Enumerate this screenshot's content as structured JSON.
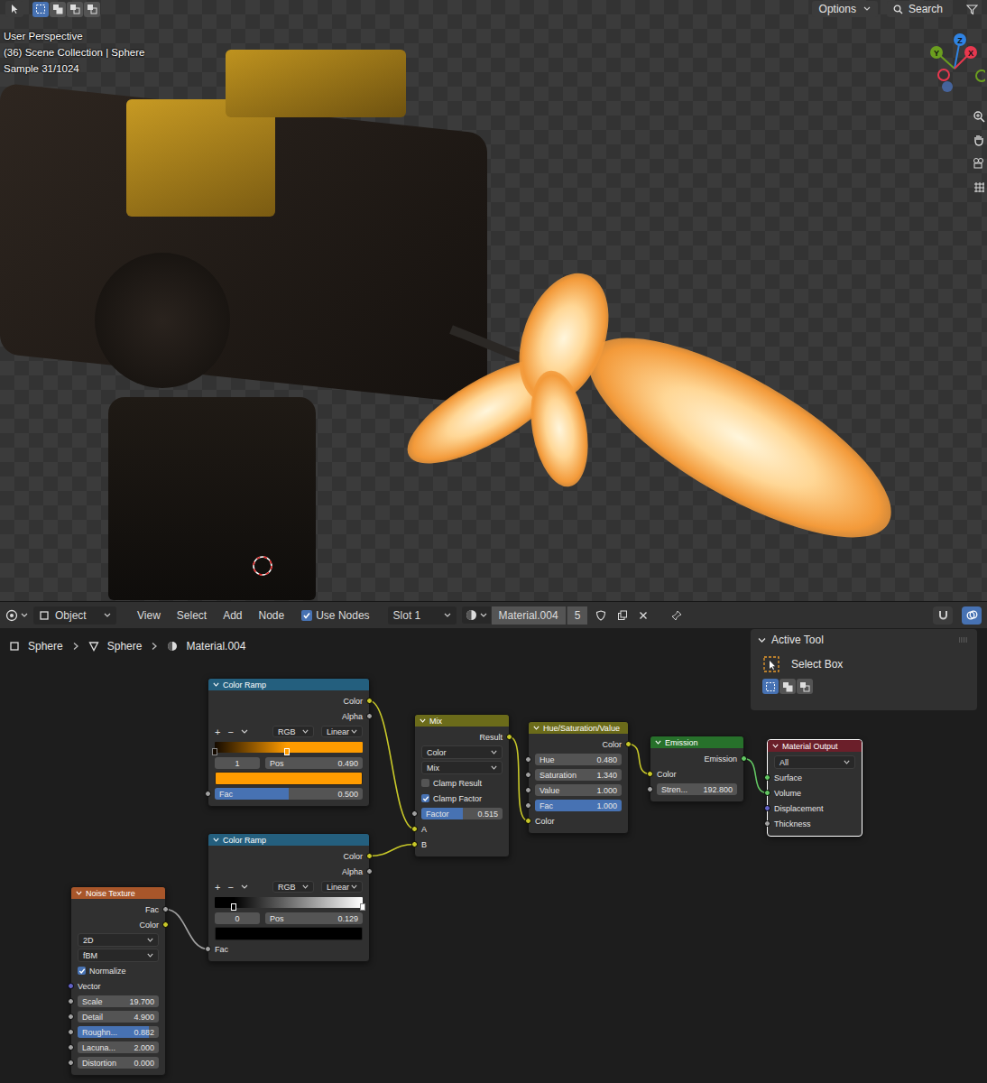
{
  "viewport": {
    "header": {
      "tool_modes": [
        {
          "selected": true
        },
        {
          "selected": false
        },
        {
          "selected": false
        },
        {
          "selected": false
        }
      ],
      "options": "Options",
      "search": "Search"
    },
    "overlay": [
      "User Perspective",
      "(36) Scene Collection | Sphere",
      "Sample 31/1024"
    ],
    "gizmo": {
      "axes": [
        {
          "label": "Y",
          "color": "#6b9e1f"
        },
        {
          "label": "Z",
          "color": "#2f83e3"
        },
        {
          "label": "X",
          "color": "#e8384f"
        }
      ]
    }
  },
  "editor_header": {
    "mode": "Object",
    "menus": [
      "View",
      "Select",
      "Add",
      "Node"
    ],
    "use_nodes": {
      "label": "Use Nodes",
      "checked": true
    },
    "slot": "Slot 1",
    "material": "Material.004",
    "users": "5",
    "toggles": [
      {
        "selected": false
      },
      {
        "selected": true
      }
    ]
  },
  "breadcrumb": [
    "Sphere",
    "Sphere",
    "Material.004"
  ],
  "active_tool": {
    "title": "Active Tool",
    "tool": "Select Box",
    "modes": [
      {
        "selected": true
      },
      {
        "selected": false
      },
      {
        "selected": false
      }
    ]
  },
  "nodes": [
    {
      "title": "Color Ramp",
      "color": "#245f7e",
      "selected": false,
      "rows": [
        {
          "kind": "output",
          "label": "Color",
          "socket": "color"
        },
        {
          "kind": "output",
          "label": "Alpha",
          "socket": "float"
        },
        {
          "kind": "ramp_tools",
          "buttons": [
            "+",
            "−"
          ],
          "mode": "RGB",
          "interpolation": "Linear"
        },
        {
          "kind": "ramp",
          "stops": [
            {
              "pos": 0,
              "color": "#140a00",
              "selected": false
            },
            {
              "pos": 0.49,
              "color": "#ff9c00",
              "selected": true
            }
          ]
        },
        {
          "kind": "stop",
          "index": "1",
          "label": "Pos",
          "value": "0.490"
        },
        {
          "kind": "swatch",
          "color": "#ff9c00"
        },
        {
          "kind": "field",
          "label": "Fac",
          "value": "0.500",
          "level": 0.5,
          "socket": "float"
        }
      ]
    },
    {
      "title": "Color Ramp",
      "color": "#245f7e",
      "selected": false,
      "rows": [
        {
          "kind": "output",
          "label": "Color",
          "socket": "color"
        },
        {
          "kind": "output",
          "label": "Alpha",
          "socket": "float"
        },
        {
          "kind": "ramp_tools",
          "buttons": [
            "+",
            "−"
          ],
          "mode": "RGB",
          "interpolation": "Linear"
        },
        {
          "kind": "ramp",
          "stops": [
            {
              "pos": 0.129,
              "color": "#000000",
              "selected": true
            },
            {
              "pos": 1,
              "color": "#ffffff",
              "selected": false
            }
          ]
        },
        {
          "kind": "stop",
          "index": "0",
          "label": "Pos",
          "value": "0.129"
        },
        {
          "kind": "swatch",
          "color": "#000000"
        },
        {
          "kind": "input",
          "label": "Fac",
          "socket": "float"
        }
      ]
    },
    {
      "title": "Noise Texture",
      "color": "#a8562a",
      "selected": false,
      "rows": [
        {
          "kind": "output",
          "label": "Fac",
          "socket": "float"
        },
        {
          "kind": "output",
          "label": "Color",
          "socket": "color"
        },
        {
          "kind": "dropdown",
          "value": "2D"
        },
        {
          "kind": "dropdown",
          "value": "fBM"
        },
        {
          "kind": "check",
          "label": "Normalize",
          "checked": true
        },
        {
          "kind": "input",
          "label": "Vector",
          "socket": "vector"
        },
        {
          "kind": "field",
          "label": "Scale",
          "value": "19.700",
          "socket": "float"
        },
        {
          "kind": "field",
          "label": "Detail",
          "value": "4.900",
          "socket": "float"
        },
        {
          "kind": "field",
          "label": "Roughn...",
          "value": "0.882",
          "level": 0.882,
          "socket": "float"
        },
        {
          "kind": "field",
          "label": "Lacuna...",
          "value": "2.000",
          "socket": "float"
        },
        {
          "kind": "field",
          "label": "Distortion",
          "value": "0.000",
          "socket": "float"
        }
      ]
    },
    {
      "title": "Mix",
      "color": "#6b6b1a",
      "selected": false,
      "rows": [
        {
          "kind": "output",
          "label": "Result",
          "socket": "color"
        },
        {
          "kind": "dropdown",
          "value": "Color"
        },
        {
          "kind": "dropdown",
          "value": "Mix"
        },
        {
          "kind": "check",
          "label": "Clamp Result",
          "checked": false
        },
        {
          "kind": "check",
          "label": "Clamp Factor",
          "checked": true
        },
        {
          "kind": "field",
          "label": "Factor",
          "value": "0.515",
          "level": 0.515,
          "socket": "float"
        },
        {
          "kind": "input",
          "label": "A",
          "socket": "color"
        },
        {
          "kind": "input",
          "label": "B",
          "socket": "color"
        }
      ]
    },
    {
      "title": "Hue/Saturation/Value",
      "color": "#6b6b1a",
      "selected": false,
      "rows": [
        {
          "kind": "output",
          "label": "Color",
          "socket": "color"
        },
        {
          "kind": "field",
          "label": "Hue",
          "value": "0.480",
          "socket": "float"
        },
        {
          "kind": "field",
          "label": "Saturation",
          "value": "1.340",
          "socket": "float"
        },
        {
          "kind": "field",
          "label": "Value",
          "value": "1.000",
          "socket": "float"
        },
        {
          "kind": "field",
          "label": "Fac",
          "value": "1.000",
          "level": 1,
          "socket": "float"
        },
        {
          "kind": "input",
          "label": "Color",
          "socket": "color"
        }
      ]
    },
    {
      "title": "Emission",
      "color": "#27712b",
      "selected": false,
      "rows": [
        {
          "kind": "output",
          "label": "Emission",
          "socket": "shader"
        },
        {
          "kind": "input",
          "label": "Color",
          "socket": "color"
        },
        {
          "kind": "field",
          "label": "Stren...",
          "value": "192.800",
          "socket": "float"
        }
      ]
    },
    {
      "title": "Material Output",
      "color": "#6b1f2a",
      "selected": true,
      "rows": [
        {
          "kind": "dropdown",
          "value": "All"
        },
        {
          "kind": "input",
          "label": "Surface",
          "socket": "shader"
        },
        {
          "kind": "input",
          "label": "Volume",
          "socket": "shader"
        },
        {
          "kind": "input",
          "label": "Displacement",
          "socket": "vector"
        },
        {
          "kind": "input",
          "label": "Thickness",
          "socket": "float"
        }
      ]
    }
  ],
  "links": [
    {
      "from": {
        "node": 0,
        "socket": "Color"
      },
      "to": {
        "node": 3,
        "socket": "A"
      }
    },
    {
      "from": {
        "node": 1,
        "socket": "Color"
      },
      "to": {
        "node": 3,
        "socket": "B"
      }
    },
    {
      "from": {
        "node": 2,
        "socket": "Fac"
      },
      "to": {
        "node": 1,
        "socket": "Fac"
      }
    },
    {
      "from": {
        "node": 3,
        "socket": "Result"
      },
      "to": {
        "node": 4,
        "socket": "Color"
      }
    },
    {
      "from": {
        "node": 4,
        "socket": "Color"
      },
      "to": {
        "node": 5,
        "socket": "Color"
      }
    },
    {
      "from": {
        "node": 5,
        "socket": "Emission"
      },
      "to": {
        "node": 6,
        "socket": "Volume"
      }
    }
  ]
}
